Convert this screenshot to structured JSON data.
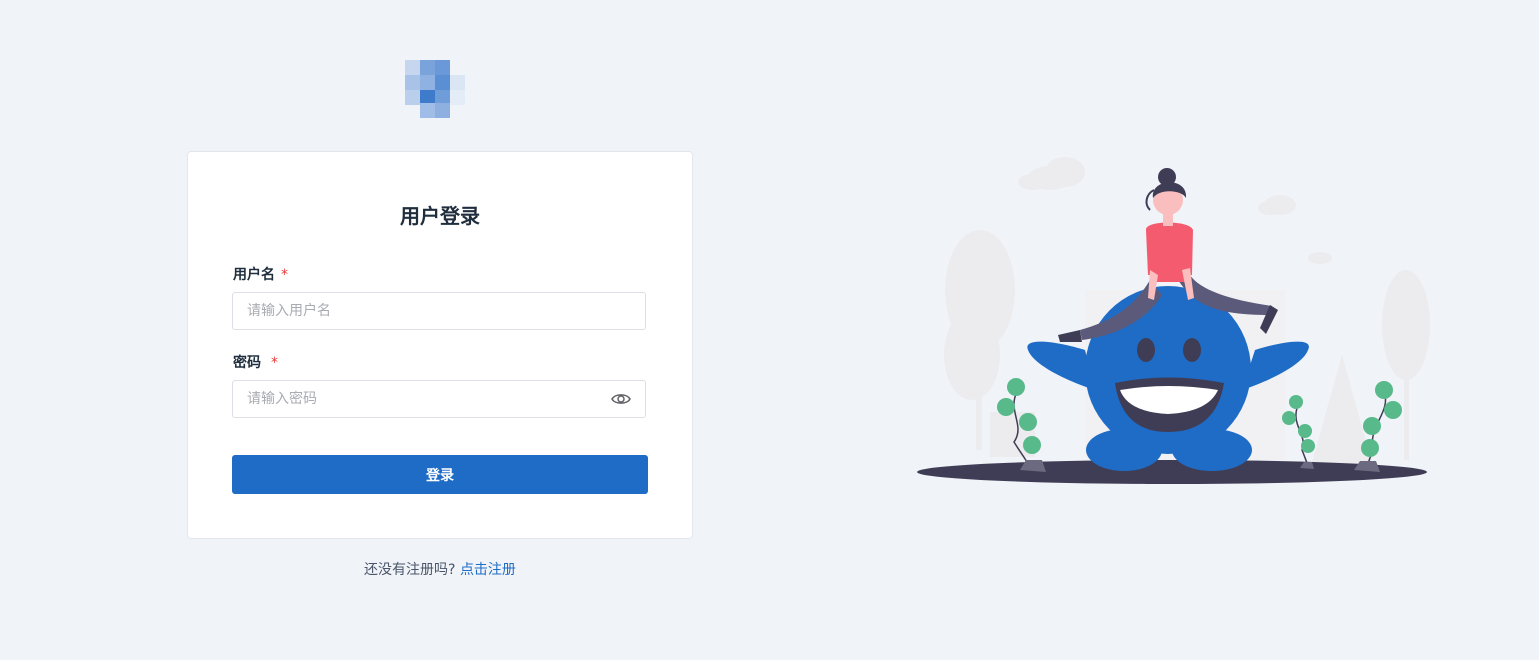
{
  "logo": {
    "icon": "blurred-pixel-logo"
  },
  "login_card": {
    "title": "用户登录",
    "username": {
      "label": "用户名",
      "required_mark": "*",
      "placeholder": "请输入用户名",
      "value": ""
    },
    "password": {
      "label": "密码",
      "required_mark": "*",
      "placeholder": "请输入密码",
      "value": "",
      "toggle_icon": "eye-icon"
    },
    "submit_label": "登录"
  },
  "register": {
    "prompt": "还没有注册吗?",
    "link_label": "点击注册"
  },
  "illustration": {
    "icon": "blue-monster-woman-illustration"
  },
  "colors": {
    "primary": "#1f6cc7",
    "background": "#f0f3f8",
    "required": "#e53935"
  }
}
